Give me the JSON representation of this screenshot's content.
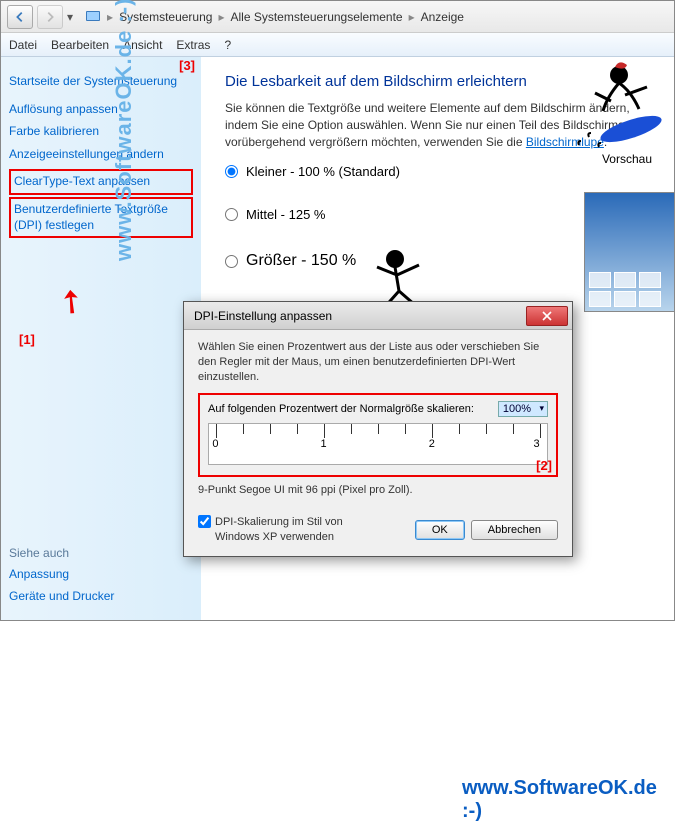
{
  "breadcrumb": {
    "item1": "Systemsteuerung",
    "item2": "Alle Systemsteuerungselemente",
    "item3": "Anzeige"
  },
  "menu": {
    "file": "Datei",
    "edit": "Bearbeiten",
    "view": "Ansicht",
    "extras": "Extras",
    "help": "?"
  },
  "sidebar": {
    "home": "Startseite der Systemsteuerung",
    "items": [
      "Auflösung anpassen",
      "Farbe kalibrieren",
      "Anzeigeeinstellungen ändern",
      "ClearType-Text anpassen",
      "Benutzerdefinierte Textgröße (DPI) festlegen"
    ],
    "see_also_hdr": "Siehe auch",
    "see_also": [
      "Anpassung",
      "Geräte und Drucker"
    ]
  },
  "annotations": {
    "n1": "[1]",
    "n2": "[2]",
    "n3": "[3]"
  },
  "content": {
    "heading": "Die Lesbarkeit auf dem Bildschirm erleichtern",
    "para": "Sie können die Textgröße und weitere Elemente auf dem Bildschirm ändern, indem Sie eine Option auswählen. Wenn Sie nur einen Teil des Bildschirms vorübergehend vergrößern möchten, verwenden Sie die",
    "link": "Bildschirmlupe",
    "dot": ".",
    "opt1": "Kleiner - 100 % (Standard)",
    "opt2": "Mittel - 125 %",
    "opt3": "Größer - 150 %",
    "preview": "Vorschau"
  },
  "dialog": {
    "title": "DPI-Einstellung anpassen",
    "intro": "Wählen Sie einen Prozentwert aus der Liste aus oder verschieben Sie den Regler mit der Maus, um einen benutzerdefinierten DPI-Wert einzustellen.",
    "scale_label": "Auf folgenden Prozentwert der Normalgröße skalieren:",
    "scale_value": "100%",
    "ruler": {
      "t0": "0",
      "t1": "1",
      "t2": "2",
      "t3": "3"
    },
    "sample": "9-Punkt Segoe UI mit 96 ppi (Pixel pro Zoll).",
    "checkbox": "DPI-Skalierung im Stil von Windows XP verwenden",
    "ok": "OK",
    "cancel": "Abbrechen"
  },
  "watermark": "www.SoftwareOK.de :-)"
}
